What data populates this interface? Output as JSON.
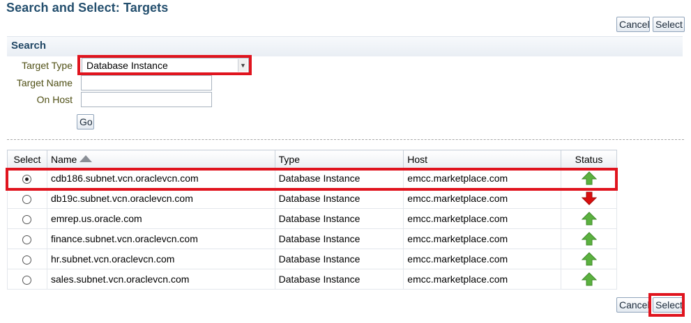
{
  "page": {
    "title": "Search and Select: Targets"
  },
  "actions": {
    "cancel_label": "Cancel",
    "select_label": "Select"
  },
  "search": {
    "header": "Search",
    "target_type_label": "Target Type",
    "target_type_value": "Database Instance",
    "target_name_label": "Target Name",
    "target_name_value": "",
    "on_host_label": "On Host",
    "on_host_value": "",
    "go_label": "Go"
  },
  "results": {
    "columns": [
      "Select",
      "Name",
      "Type",
      "Host",
      "Status"
    ],
    "sort_column": "Name",
    "rows": [
      {
        "selected": true,
        "name": "cdb186.subnet.vcn.oraclevcn.com",
        "type": "Database Instance",
        "host": "emcc.marketplace.com",
        "status": "up"
      },
      {
        "selected": false,
        "name": "db19c.subnet.vcn.oraclevcn.com",
        "type": "Database Instance",
        "host": "emcc.marketplace.com",
        "status": "down"
      },
      {
        "selected": false,
        "name": "emrep.us.oracle.com",
        "type": "Database Instance",
        "host": "emcc.marketplace.com",
        "status": "up"
      },
      {
        "selected": false,
        "name": "finance.subnet.vcn.oraclevcn.com",
        "type": "Database Instance",
        "host": "emcc.marketplace.com",
        "status": "up"
      },
      {
        "selected": false,
        "name": "hr.subnet.vcn.oraclevcn.com",
        "type": "Database Instance",
        "host": "emcc.marketplace.com",
        "status": "up"
      },
      {
        "selected": false,
        "name": "sales.subnet.vcn.oraclevcn.com",
        "type": "Database Instance",
        "host": "emcc.marketplace.com",
        "status": "up"
      }
    ]
  },
  "icons": {
    "status_up": "arrow-up-icon",
    "status_down": "arrow-down-icon",
    "sort": "sort-ascending-icon"
  },
  "colors": {
    "title": "#244f6e",
    "highlight": "#e0141e",
    "status_up": "#5bb13f",
    "status_down": "#d90f0f"
  }
}
